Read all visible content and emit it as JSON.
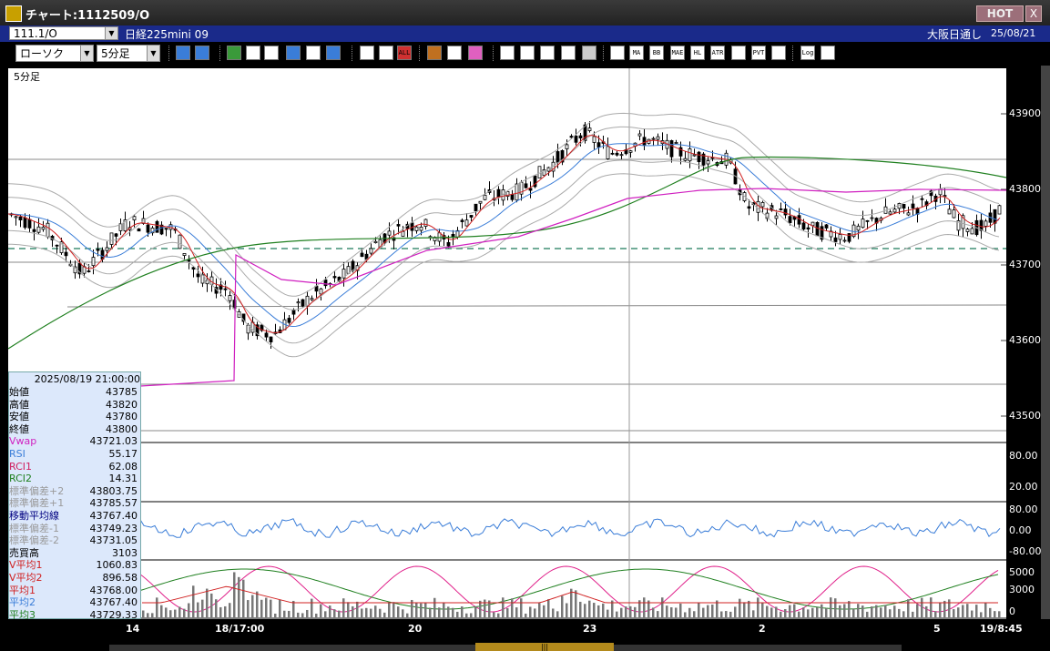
{
  "window": {
    "title": "チャート:1112509/O",
    "hot": "HOT",
    "close": "X"
  },
  "symbolbar": {
    "symbol": "111.1/O",
    "name": "日経225mini 09",
    "market": "大阪日通し",
    "date": "25/08/21"
  },
  "toolbar": {
    "chart_type": "ローソク",
    "interval": "5分足",
    "icons": [
      {
        "name": "zoom-icon",
        "label": "",
        "color": "#3a7dd8"
      },
      {
        "name": "window-icon",
        "label": "",
        "color": "#3a7dd8"
      },
      {
        "name": "pen-icon",
        "label": "",
        "color": "#3a9a3a"
      },
      {
        "name": "eraser-icon",
        "label": "",
        "color": "#ffffff"
      },
      {
        "name": "cursor-icon",
        "label": "",
        "color": "#ffffff"
      },
      {
        "name": "undo-icon",
        "label": "",
        "color": "#3a7dd8"
      },
      {
        "name": "memo-icon",
        "label": "",
        "color": "#ffffff"
      },
      {
        "name": "trash-icon",
        "label": "",
        "color": "#3a7dd8"
      },
      {
        "name": "candle-icon",
        "label": "",
        "color": "#ffffff"
      },
      {
        "name": "candle-delete-icon",
        "label": "",
        "color": "#ffffff"
      },
      {
        "name": "all-icon",
        "label": "ALL",
        "color": "#d03030"
      },
      {
        "name": "settings-icon",
        "label": "",
        "color": "#c07020"
      },
      {
        "name": "tool-icon",
        "label": "",
        "color": "#ffffff"
      },
      {
        "name": "palette-icon",
        "label": "",
        "color": "#e060c0"
      },
      {
        "name": "download-icon",
        "label": "",
        "color": "#ffffff"
      },
      {
        "name": "search-icon",
        "label": "",
        "color": "#ffffff"
      },
      {
        "name": "compare-icon",
        "label": "",
        "color": "#ffffff"
      },
      {
        "name": "transfer-icon",
        "label": "",
        "color": "#ffffff"
      },
      {
        "name": "note-icon",
        "label": "",
        "color": "#cccccc"
      },
      {
        "name": "chart-list-icon",
        "label": "",
        "color": "#ffffff"
      },
      {
        "name": "ma-icon",
        "label": "MA",
        "color": "#ffffff"
      },
      {
        "name": "bb-icon",
        "label": "BB",
        "color": "#ffffff"
      },
      {
        "name": "mae-icon",
        "label": "MAE",
        "color": "#ffffff"
      },
      {
        "name": "hl-icon",
        "label": "HL",
        "color": "#ffffff"
      },
      {
        "name": "atr-icon",
        "label": "ATR",
        "color": "#ffffff"
      },
      {
        "name": "pbr-icon",
        "label": "",
        "color": "#ffffff"
      },
      {
        "name": "pvt-icon",
        "label": "PVT",
        "color": "#ffffff"
      },
      {
        "name": "box-icon",
        "label": "",
        "color": "#ffffff"
      },
      {
        "name": "log-icon",
        "label": "Log",
        "color": "#ffffff"
      },
      {
        "name": "exit-icon",
        "label": "",
        "color": "#ffffff"
      }
    ]
  },
  "chart": {
    "interval_label": "5分足"
  },
  "price_axis": [
    "43900",
    "43800",
    "43700",
    "43600",
    "43500"
  ],
  "rsi_axis": [
    "80.00",
    "20.00"
  ],
  "rci_axis": [
    "80.00",
    "0.00",
    "-80.00"
  ],
  "volume_axis": [
    "5000",
    "3000",
    "0"
  ],
  "x_axis": [
    "14",
    "18/17:00",
    "20",
    "23",
    "2",
    "5",
    "19/8:45"
  ],
  "info_panel": {
    "datetime": "2025/08/19 21:00:00",
    "rows": [
      {
        "label": "始値",
        "value": "43785",
        "color": "#000000"
      },
      {
        "label": "高値",
        "value": "43820",
        "color": "#000000"
      },
      {
        "label": "安値",
        "value": "43780",
        "color": "#000000"
      },
      {
        "label": "終値",
        "value": "43800",
        "color": "#000000"
      },
      {
        "label": "Vwap",
        "value": "43721.03",
        "color": "#d020c0"
      },
      {
        "label": "RSI",
        "value": "55.17",
        "color": "#3a7dd8"
      },
      {
        "label": "RCI1",
        "value": "62.08",
        "color": "#d02060"
      },
      {
        "label": "RCI2",
        "value": "14.31",
        "color": "#208020"
      },
      {
        "label": "標準偏差+2",
        "value": "43803.75",
        "color": "#9a9a9a"
      },
      {
        "label": "標準偏差+1",
        "value": "43785.57",
        "color": "#9a9a9a"
      },
      {
        "label": "移動平均線",
        "value": "43767.40",
        "color": "#000080"
      },
      {
        "label": "標準偏差-1",
        "value": "43749.23",
        "color": "#9a9a9a"
      },
      {
        "label": "標準偏差-2",
        "value": "43731.05",
        "color": "#9a9a9a"
      },
      {
        "label": "売買高",
        "value": "3103",
        "color": "#000000"
      },
      {
        "label": "V平均1",
        "value": "1060.83",
        "color": "#d02020"
      },
      {
        "label": "V平均2",
        "value": "896.58",
        "color": "#d02020"
      },
      {
        "label": "平均1",
        "value": "43768.00",
        "color": "#d02020"
      },
      {
        "label": "平均2",
        "value": "43767.40",
        "color": "#3a7dd8"
      },
      {
        "label": "平均3",
        "value": "43729.33",
        "color": "#208020"
      }
    ]
  },
  "colors": {
    "accent": "#1a2a8a",
    "hot": "#9c6f7a",
    "ma_short": "#d02020",
    "ma_mid": "#3a7dd8",
    "ma_long": "#208020",
    "vwap": "#d020c0",
    "band": "#a0a0a0"
  }
}
